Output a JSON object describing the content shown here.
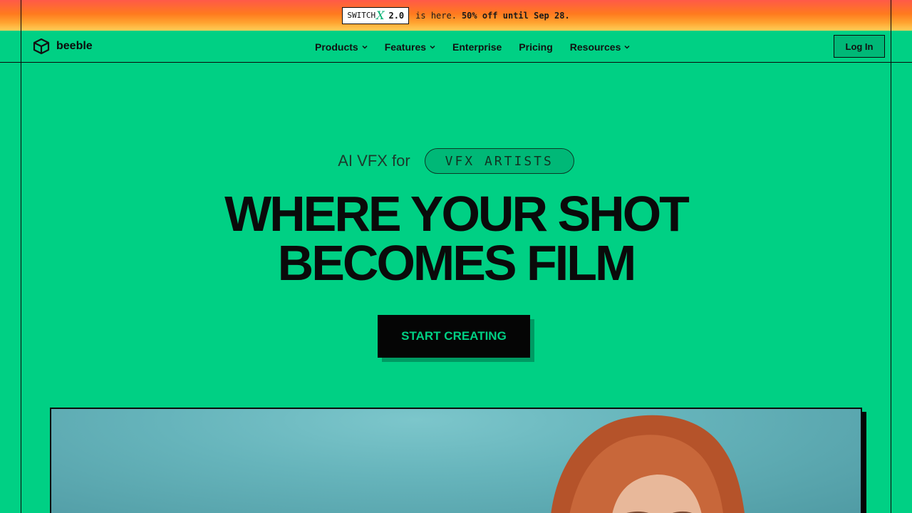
{
  "promo": {
    "badge_prefix": "SWITCH",
    "badge_glyph": "X",
    "badge_version": "2.0",
    "text": "is here.",
    "offer": "50% off until Sep 28."
  },
  "header": {
    "logo_text": "beeble",
    "nav": [
      {
        "label": "Products",
        "has_dropdown": true
      },
      {
        "label": "Features",
        "has_dropdown": true
      },
      {
        "label": "Enterprise",
        "has_dropdown": false
      },
      {
        "label": "Pricing",
        "has_dropdown": false
      },
      {
        "label": "Resources",
        "has_dropdown": true
      }
    ],
    "login_label": "Log In"
  },
  "hero": {
    "tagline_prefix": "AI VFX for",
    "tagline_pill": "VFX ARTISTS",
    "headline_line1": "WHERE YOUR SHOT",
    "headline_line2": "BECOMES FILM",
    "cta_label": "START CREATING"
  },
  "colors": {
    "background": "#00d084",
    "ink": "#0b0b0b",
    "promo_gradient_top": "#ff5a48",
    "promo_gradient_bottom": "#ffcf5a",
    "cta_text": "#00d084"
  },
  "icons": {
    "logo": "cube-logo-icon",
    "nav_dropdown": "chevron-down-icon"
  }
}
